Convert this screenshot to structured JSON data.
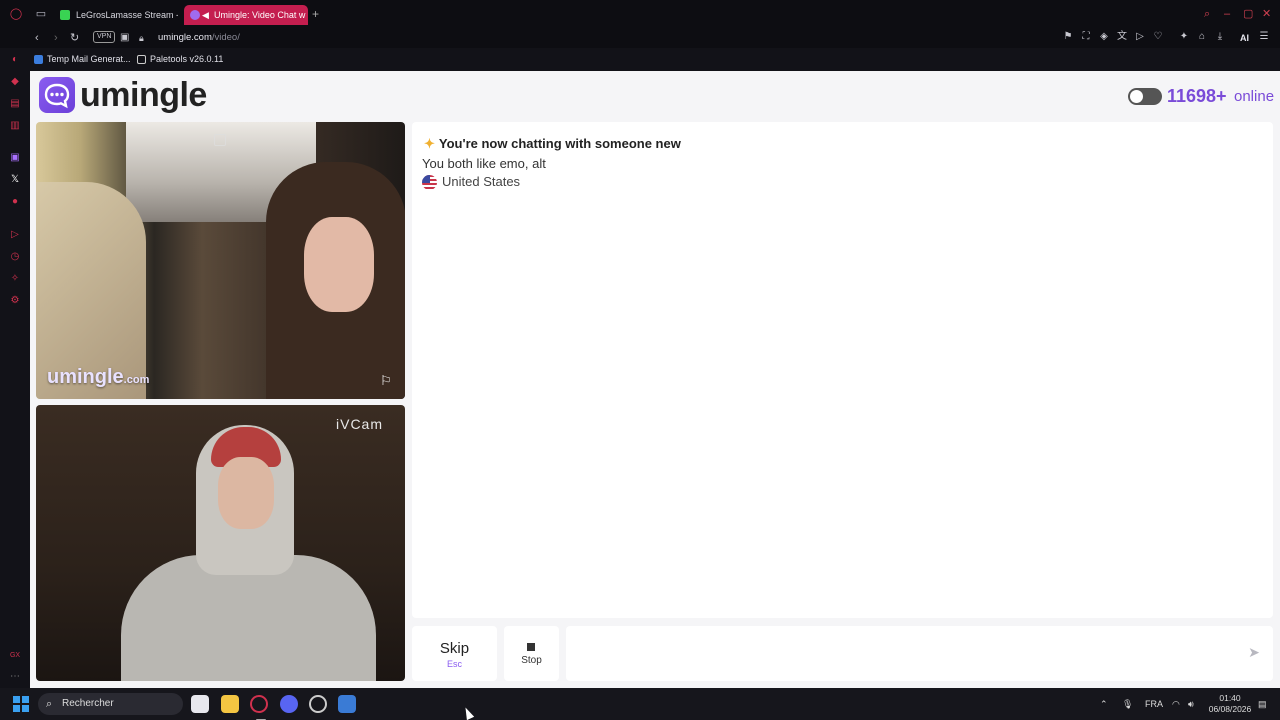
{
  "browser": {
    "tabs": [
      {
        "label": "LeGrosLamasse Stream - V",
        "active": false
      },
      {
        "label": "Umingle: Video Chat w",
        "active": true
      }
    ],
    "new_tab_label": "+",
    "url_host": "umingle.com",
    "url_path": "/video/",
    "vpn_label": "VPN",
    "ai_label": "AI",
    "bookmarks": [
      {
        "label": "Temp Mail Generat..."
      },
      {
        "label": "Paletools v26.0.11"
      }
    ]
  },
  "site": {
    "logo_text": "umingle",
    "online_count": "11698+",
    "online_label": "online",
    "watermark_main": "umingle",
    "watermark_suffix": ".com",
    "self_cam_label": "iVCam"
  },
  "chat": {
    "messages": [
      {
        "text": "You're now chatting with someone new"
      },
      {
        "text": "You both like emo, alt"
      },
      {
        "text": "United States"
      }
    ],
    "input_placeholder": ""
  },
  "controls": {
    "skip_label": "Skip",
    "skip_hint": "Esc",
    "stop_label": "Stop"
  },
  "taskbar": {
    "search_placeholder": "Rechercher",
    "lang": "FRA",
    "time": "01:40",
    "date": "06/08/2026"
  },
  "colors": {
    "accent": "#7a4bd8",
    "opera_red": "#c41e4f",
    "page_bg": "#f5f5f7"
  },
  "icons": [
    "opera-icon",
    "tab-overview-icon",
    "back-icon",
    "forward-icon",
    "reload-icon",
    "camera-icon",
    "lock-icon",
    "send-icon",
    "stop-icon",
    "flag-icon",
    "picture-in-picture-icon",
    "windows-start-icon",
    "search-icon",
    "wifi-icon",
    "volume-icon",
    "mic-icon",
    "notification-icon"
  ]
}
